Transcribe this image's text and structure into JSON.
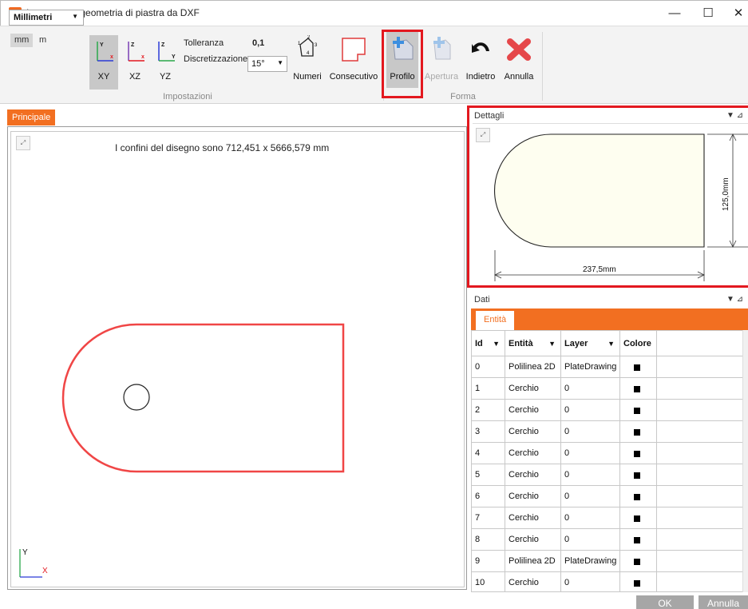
{
  "window": {
    "title": "Importa una geometria di piastra da DXF",
    "minimize_glyph": "—",
    "maximize_glyph": "☐",
    "close_glyph": "✕"
  },
  "ribbon": {
    "units": {
      "selected": "Millimetri",
      "options": [
        "mm",
        "m"
      ],
      "active_option": "mm"
    },
    "planes": [
      {
        "label": "XY",
        "active": true,
        "axis_a": "Y",
        "axis_b": "x"
      },
      {
        "label": "XZ",
        "active": false,
        "axis_a": "Z",
        "axis_b": "x"
      },
      {
        "label": "YZ",
        "active": false,
        "axis_a": "Z",
        "axis_b": "Y"
      }
    ],
    "tolerance_label": "Tolleranza",
    "tolerance_value": "0,1",
    "discretization_label": "Discretizzazione",
    "discretization_value": "15°",
    "numbers_label": "Numeri",
    "consecutive_label": "Consecutivo",
    "impostazioni_label": "Impostazioni",
    "profile_label": "Profilo",
    "opening_label": "Apertura",
    "back_label": "Indietro",
    "cancel_label": "Annulla",
    "forma_label": "Forma",
    "numbers_icon_digits": [
      "1",
      "2",
      "3",
      "4"
    ]
  },
  "main": {
    "tab_label": "Principale",
    "bounds_text": "I confini del disegno sono  712,451 x  5666,579 mm",
    "axis_x": "X",
    "axis_y": "Y",
    "colors": {
      "shape_stroke": "#f04646"
    }
  },
  "details": {
    "title": "Dettagli",
    "width_dimension": "237,5mm",
    "height_dimension": "125,0mm",
    "colors": {
      "shape_fill": "#fefef0"
    }
  },
  "data_panel": {
    "title": "Dati",
    "tab_label": "Entità",
    "columns": [
      "Id",
      "Entità",
      "Layer",
      "Colore"
    ],
    "rows": [
      {
        "id": "0",
        "entity": "Polilinea 2D",
        "layer": "PlateDrawing"
      },
      {
        "id": "1",
        "entity": "Cerchio",
        "layer": "0"
      },
      {
        "id": "2",
        "entity": "Cerchio",
        "layer": "0"
      },
      {
        "id": "3",
        "entity": "Cerchio",
        "layer": "0"
      },
      {
        "id": "4",
        "entity": "Cerchio",
        "layer": "0"
      },
      {
        "id": "5",
        "entity": "Cerchio",
        "layer": "0"
      },
      {
        "id": "6",
        "entity": "Cerchio",
        "layer": "0"
      },
      {
        "id": "7",
        "entity": "Cerchio",
        "layer": "0"
      },
      {
        "id": "8",
        "entity": "Cerchio",
        "layer": "0"
      },
      {
        "id": "9",
        "entity": "Polilinea 2D",
        "layer": "PlateDrawing"
      },
      {
        "id": "10",
        "entity": "Cerchio",
        "layer": "0"
      }
    ],
    "color_swatch": "#000000"
  },
  "footer": {
    "ok_label": "OK",
    "cancel_label": "Annulla"
  },
  "accent_color": "#f26f21",
  "highlight_color": "#e3181f"
}
